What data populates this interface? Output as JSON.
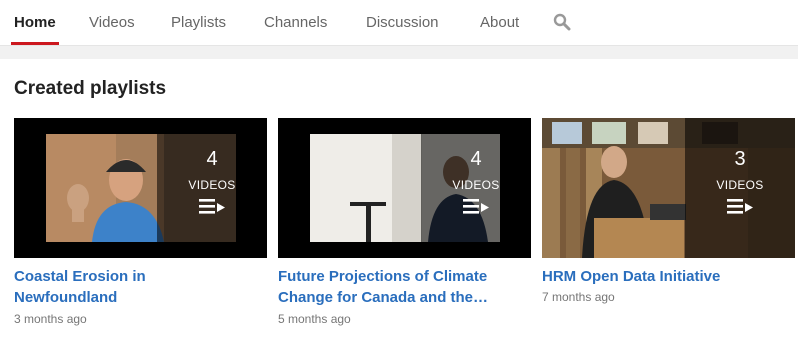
{
  "tabs": [
    {
      "label": "Home",
      "active": true
    },
    {
      "label": "Videos"
    },
    {
      "label": "Playlists"
    },
    {
      "label": "Channels"
    },
    {
      "label": "Discussion"
    },
    {
      "label": "About"
    }
  ],
  "search": {
    "icon": "search-icon"
  },
  "section": {
    "title": "Created playlists"
  },
  "playlists": [
    {
      "title_line1": "Coastal Erosion in",
      "title_line2": "Newfoundland",
      "age": "3 months ago",
      "count": "4",
      "count_label": "VIDEOS"
    },
    {
      "title_line1": "Future Projections of Climate",
      "title_line2": "Change for Canada and the…",
      "age": "5 months ago",
      "count": "4",
      "count_label": "VIDEOS"
    },
    {
      "title_line1": "HRM Open Data Initiative",
      "title_line2": "",
      "age": "7 months ago",
      "count": "3",
      "count_label": "VIDEOS"
    }
  ],
  "colors": {
    "accent_underline": "#cc181e",
    "link": "#2a6ebd",
    "meta": "#767676"
  }
}
